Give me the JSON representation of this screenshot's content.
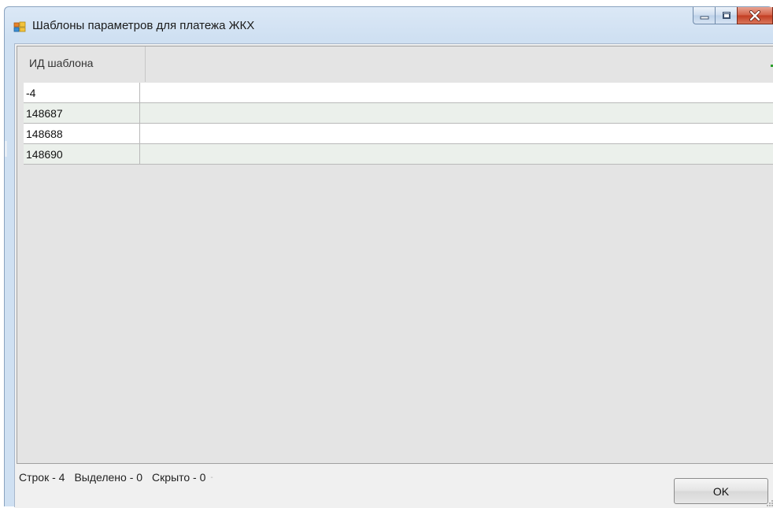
{
  "window": {
    "title": "Шаблоны параметров для платежа ЖКХ",
    "icon": "app-window-icon"
  },
  "titlebar_buttons": {
    "minimize": "minimize-icon",
    "maximize": "maximize-icon",
    "close": "close-icon"
  },
  "grid": {
    "columns": [
      {
        "header": "ИД шаблона"
      }
    ],
    "rows": [
      {
        "id": "-4"
      },
      {
        "id": "148687"
      },
      {
        "id": "148688"
      },
      {
        "id": "148690"
      }
    ],
    "row_colors": {
      "odd": "#ffffff",
      "even": "#ebf0eb"
    }
  },
  "status": {
    "rows": "Строк - 4",
    "selected": "Выделено - 0",
    "hidden": "Скрыто - 0"
  },
  "buttons": {
    "ok": "OK"
  },
  "colors": {
    "window_frame": "#cfe0f2",
    "close_button": "#c23b21",
    "grid_background": "#e4e4e4"
  }
}
